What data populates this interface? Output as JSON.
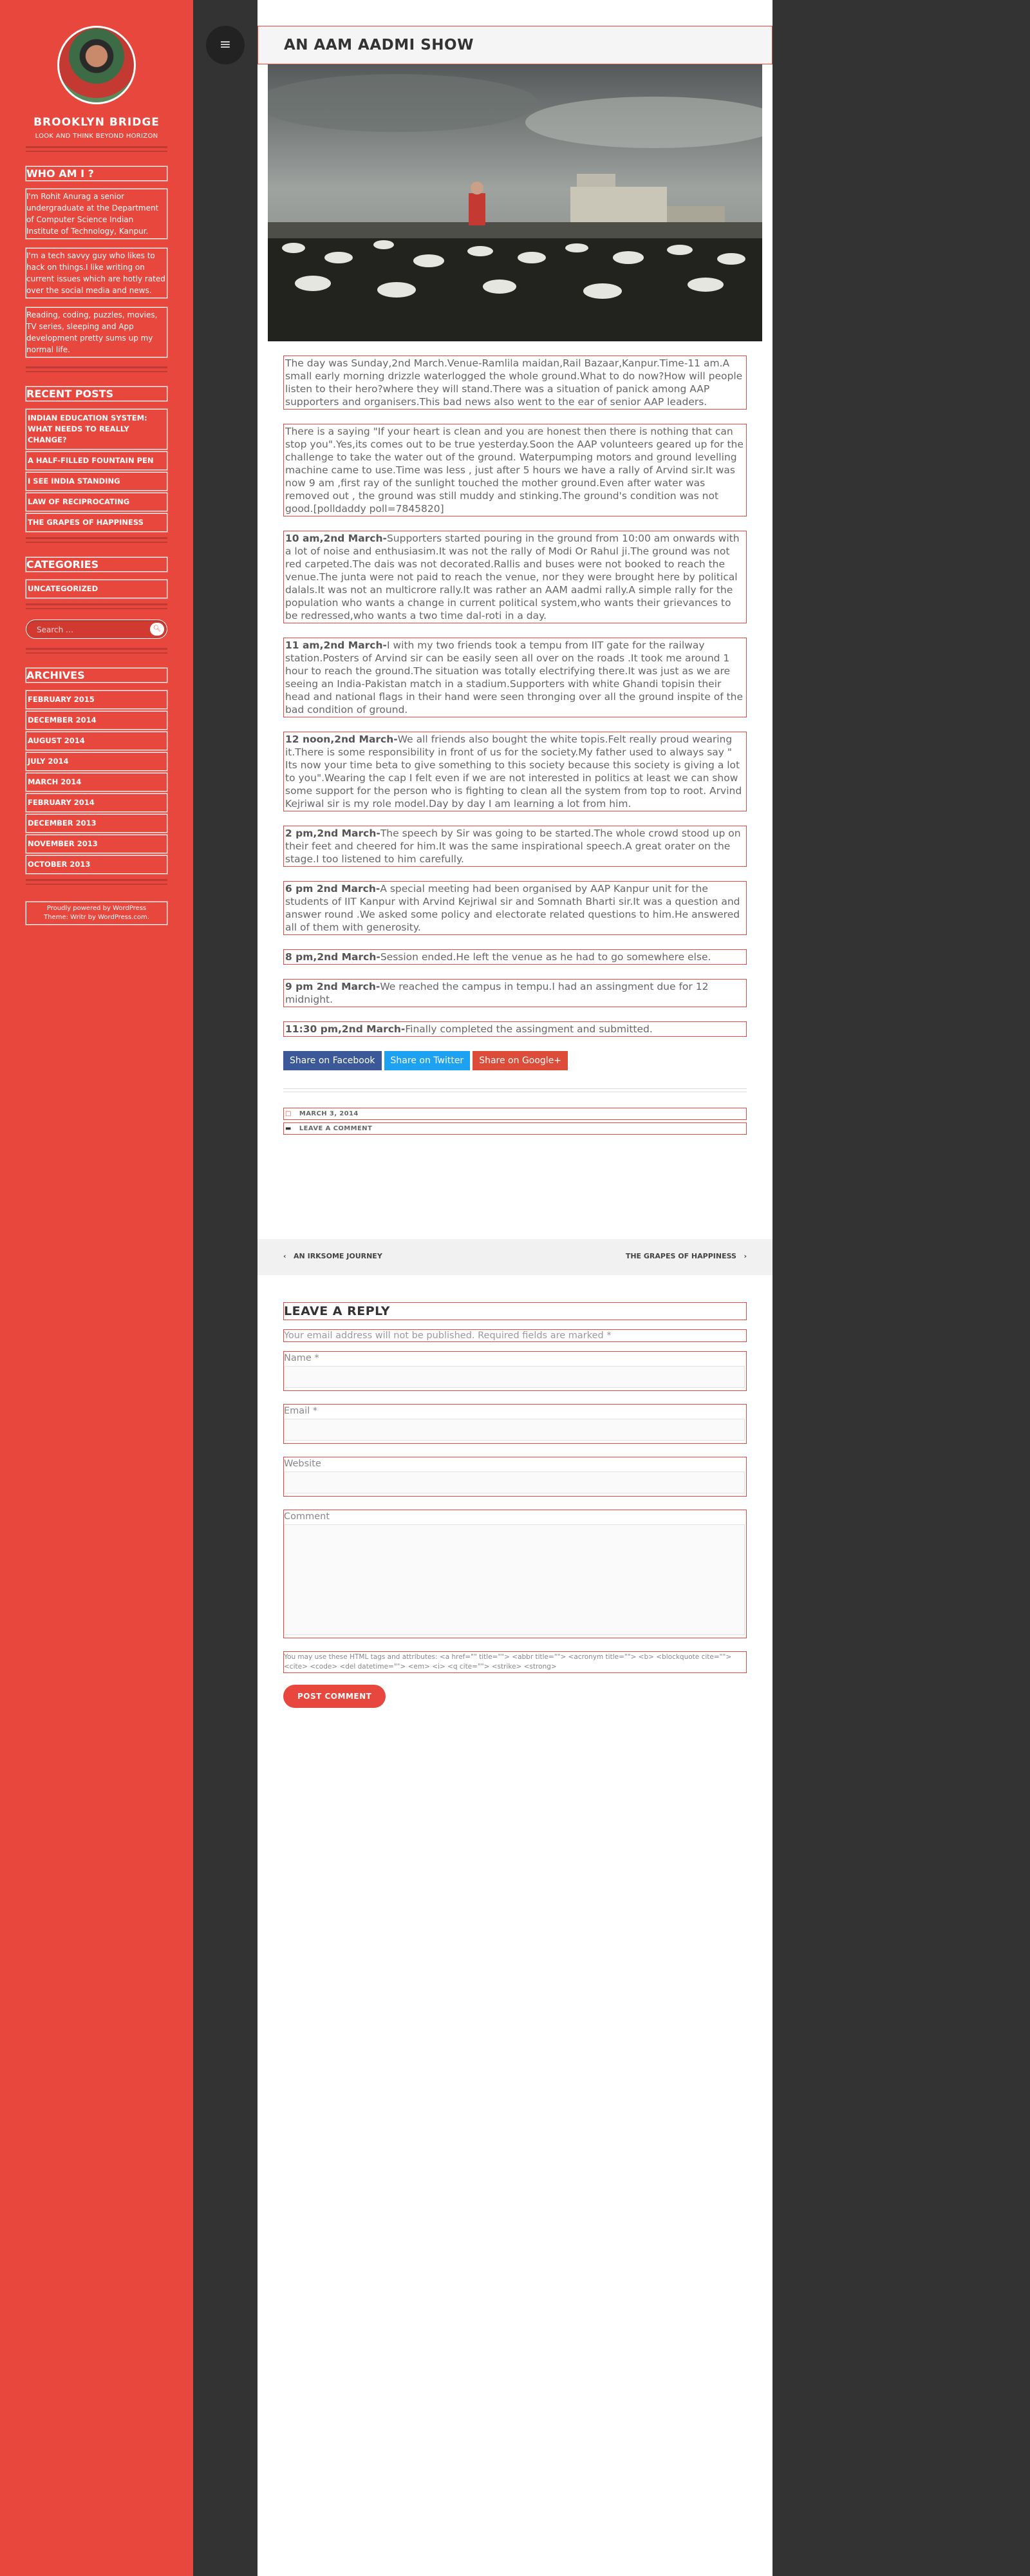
{
  "site": {
    "title": "BROOKLYN BRIDGE",
    "description": "LOOK AND THINK BEYOND HORIZON"
  },
  "sidebar": {
    "about_title": "WHO AM I ?",
    "about_paragraphs": [
      "I'm Rohit Anurag a senior undergraduate at the Department of Computer Science Indian Institute of Technology, Kanpur.",
      "I'm a tech savvy guy who likes to hack on things.I like writing on current issues which are hotly rated over the social media and news.",
      "Reading, coding, puzzles, movies, TV series, sleeping and App development pretty sums up my normal life."
    ],
    "recent_title": "RECENT POSTS",
    "recent_posts": [
      "INDIAN EDUCATION SYSTEM: WHAT NEEDS TO REALLY CHANGE?",
      "A HALF-FILLED FOUNTAIN PEN",
      "I SEE INDIA STANDING",
      "LAW OF RECIPROCATING",
      "THE GRAPES OF HAPPINESS"
    ],
    "categories_title": "CATEGORIES",
    "categories": [
      "UNCATEGORIZED"
    ],
    "search_placeholder": "Search …",
    "archives_title": "ARCHIVES",
    "archives": [
      "FEBRUARY 2015",
      "DECEMBER 2014",
      "AUGUST 2014",
      "JULY 2014",
      "MARCH 2014",
      "FEBRUARY 2014",
      "DECEMBER 2013",
      "NOVEMBER 2013",
      "OCTOBER 2013"
    ],
    "footer_line1": "Proudly powered by WordPress",
    "footer_line2": "Theme: Writr by WordPress.com."
  },
  "post": {
    "title": "AN AAM AADMI SHOW",
    "paragraphs": [
      {
        "lead": "",
        "text": "The day was Sunday,2nd March.Venue-Ramlila maidan,Rail Bazaar,Kanpur.Time-11 am.A small early morning drizzle waterlogged the whole ground.What to do now?How will people listen to their hero?where they will stand.There was a situation of panick among AAP supporters and organisers.This bad news also went to the ear of senior AAP leaders."
      },
      {
        "lead": "",
        "text": "There is a saying \"If your heart is clean and you are honest then there is nothing that can stop you\".Yes,its comes out to be true yesterday.Soon the AAP volunteers geared up for the challenge to take the water out of the ground.  Waterpumping motors and  ground levelling machine came to use.Time was less , just after 5 hours we have a rally of Arvind sir.It was now 9 am ,first ray of the sunlight touched the mother ground.Even after water was removed out , the ground was still muddy and stinking.The ground's condition was not good.[polldaddy poll=7845820]"
      },
      {
        "lead": "10 am,2nd March-",
        "text": "Supporters started pouring in the ground from 10:00 am onwards with a lot of noise and enthusiasim.It was not the rally of Modi Or Rahul ji.The ground was not red carpeted.The dais was not decorated.Rallis and buses were not booked to reach the venue.The junta were not paid to reach the venue, nor they were brought here by political dalals.It was not an multicrore rally.It was rather an AAM aadmi rally.A simple rally for the population who wants a change in current political system,who wants their grievances to be redressed,who wants a two time dal-roti in a day."
      },
      {
        "lead": "11 am,2nd March-",
        "text": "I with my two friends took a tempu from IIT gate for the railway station.Posters of Arvind sir can be easily seen all over on the roads .It took me around 1 hour to reach the ground.The situation was totally electrifying there.It was just as we are seeing an India-Pakistan match in a stadium.Supporters with white Ghandi topisin their head and national flags in their hand were seen thronging over all the ground inspite of the bad condition of ground."
      },
      {
        "lead": "12 noon,2nd March-",
        "text": "We all friends also bought the white topis.Felt really proud wearing it.There is some responsibility in front of us for the society.My father used to always say \" Its now your time beta to give something to this society because this society is giving a lot to you\".Wearing the cap I felt even if we are not interested in politics at least we can show some support for the person who is fighting to clean all the system from top to root. Arvind Kejriwal sir is my role model.Day by day I am learning a lot from him."
      },
      {
        "lead": "2 pm,2nd March-",
        "text": "The speech by Sir was going to be started.The whole crowd stood up on their feet and cheered for him.It was the same inspirational speech.A great orater on the stage.I too listened to him carefully."
      },
      {
        "lead": "6 pm 2nd March-",
        "text": "A special meeting had been organised by AAP Kanpur unit for the students of IIT Kanpur with Arvind Kejriwal sir and Somnath Bharti sir.It was a question and answer round .We asked some policy and electorate related questions to him.He answered all of them with generosity."
      },
      {
        "lead": "8 pm,2nd March-",
        "text": "Session ended.He left the venue as he had to go somewhere else."
      },
      {
        "lead": "9 pm 2nd March-",
        "text": "We reached the campus in tempu.I had an assingment due for 12 midnight."
      },
      {
        "lead": "11:30 pm,2nd March-",
        "text": "Finally completed the assingment and submitted."
      }
    ],
    "share_facebook": "Share on Facebook",
    "share_twitter": "Share on Twitter",
    "share_google": "Share on Google+",
    "date": "MARCH 3, 2014",
    "comment_link": "LEAVE A COMMENT"
  },
  "post_nav": {
    "prev": "AN IRKSOME JOURNEY",
    "next": "THE GRAPES OF HAPPINESS"
  },
  "reply": {
    "title": "LEAVE A REPLY",
    "notes": "Your email address will not be published. Required fields are marked *",
    "name_label": "Name *",
    "email_label": "Email *",
    "website_label": "Website",
    "comment_label": "Comment",
    "allowed_tags": "You may use these HTML tags and attributes: <a href=\"\" title=\"\"> <abbr title=\"\"> <acronym title=\"\"> <b> <blockquote cite=\"\"> <cite> <code> <del datetime=\"\"> <em> <i> <q cite=\"\"> <strike> <strong>",
    "submit": "POST COMMENT"
  },
  "colors": {
    "accent": "#e8473d",
    "dark_column": "#333333"
  }
}
